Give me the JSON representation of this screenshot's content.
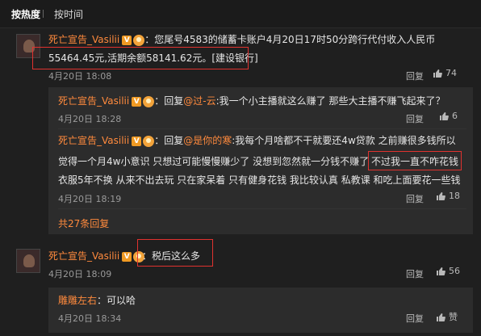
{
  "tabs": {
    "hot": "按热度",
    "time": "按时间"
  },
  "comment1": {
    "user": "死亡宣告_Vasilii",
    "v_badge": "V",
    "text_line1": "：您尾号4583的储蓄卡账户4月20日17时50分跨行代付收入人民币",
    "text_line2": "55464.45元,活期余额58141.62元。[建设银行]",
    "time": "4月20日 18:08",
    "reply_label": "回复",
    "likes": "74"
  },
  "replies": [
    {
      "user": "死亡宣告_Vasilii",
      "reply_word": "：回复",
      "mention": "@过-云",
      "text": ":我一个小主播就这么赚了 那些大主播不赚飞起来了？",
      "time": "4月20日 18:28",
      "reply_label": "回复",
      "likes": "6"
    },
    {
      "user": "死亡宣告_Vasilii",
      "reply_word": "：回复",
      "mention": "@是你的寒",
      "text_a": ":我每个月啥都不干就要还4w贷款 之前赚很多钱所以",
      "text_b": "觉得一个月4w小意识 只想过可能慢慢赚少了 没想到忽然就一分钱不赚了",
      "text_b_highlight": "不过我一直不咋花钱",
      "text_c": "衣服5年不换 从来不出去玩 只在家呆着 只有健身花钱 我比较认真 私教课 和吃上面要花一些钱",
      "time": "4月20日 18:19",
      "reply_label": "回复",
      "likes": "18"
    }
  ],
  "more_replies": "共27条回复",
  "comment2": {
    "user": "死亡宣告_Vasilii",
    "v_badge": "V",
    "text": "：税后这么多",
    "time": "4月20日 18:09",
    "reply_label": "回复",
    "likes": "56"
  },
  "reply_c2": {
    "user": "雕雕左右",
    "text": "：可以哈",
    "time": "4月20日 18:34",
    "reply_label": "回复",
    "likes": "赞"
  }
}
